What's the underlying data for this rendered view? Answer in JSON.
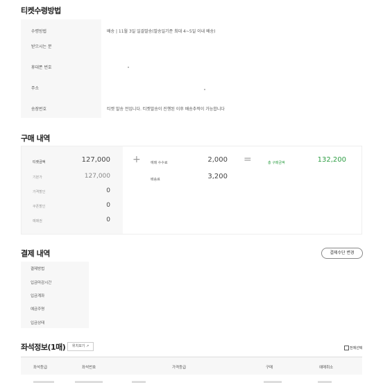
{
  "sections": {
    "receive_title": "티켓수령방법",
    "purchase_title": "구매 내역",
    "payment_title": "결제 내역",
    "seat_title": "좌석정보(1매)"
  },
  "receive": {
    "rows": [
      {
        "label": "수령방법",
        "value": "배송 | 11월 3일 일괄발송(발송일기준 최대 4~5일 이내 배송)"
      },
      {
        "label": "받으시는 분",
        "value": ""
      },
      {
        "label": "휴대폰 번호",
        "value": ""
      },
      {
        "label": "주소",
        "value": ""
      },
      {
        "label": "송장번호",
        "value": "티켓 발송 전입니다. 티켓발송이 진행된 이후 배송추적이 가능합니다"
      }
    ]
  },
  "purchase": {
    "ticket_amount_label": "티켓금액",
    "ticket_amount": "127,000",
    "base_price_label": "기본가",
    "base_price": "127,000",
    "price_discount_label": "가격할인",
    "price_discount": "0",
    "coupon_discount_label": "쿠폰할인",
    "coupon_discount": "0",
    "points_label": "예매권",
    "points": "0",
    "fee_label": "예매 수수료",
    "fee": "2,000",
    "shipping_label": "배송료",
    "shipping": "3,200",
    "total_label": "총 구매금액",
    "total": "132,200",
    "plus_symbol": "+",
    "equals_symbol": "="
  },
  "payment": {
    "change_button": "결제수단 변경",
    "rows": [
      "결제방법",
      "입금마감시간",
      "입금계좌",
      "예금주명",
      "입금상태"
    ]
  },
  "seats": {
    "view_control": "위치보기 ↗",
    "select_all": "전체선택",
    "headers": [
      "좌석등급",
      "좌석번호",
      "가격등급",
      "구매",
      "예매취소"
    ]
  },
  "colors": {
    "accent_green": "#2e9e44",
    "label_bg": "#f7f7f7"
  }
}
